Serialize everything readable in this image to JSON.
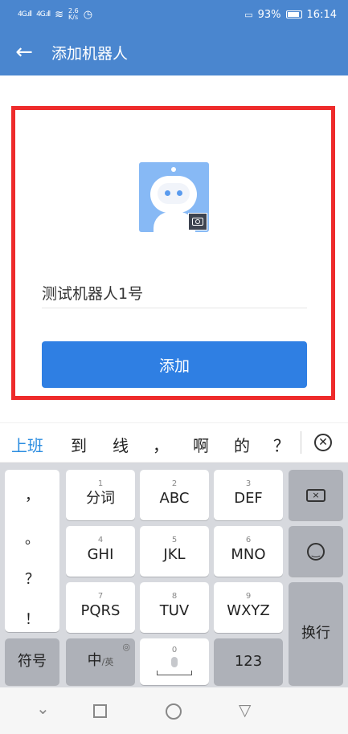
{
  "status_bar": {
    "signal1": "4G.ıll",
    "signal2": "4G.ıll",
    "net_speed": "2.6\nK/s",
    "battery_percent": "93%",
    "time": "16:14"
  },
  "app_bar": {
    "title": "添加机器人"
  },
  "form": {
    "robot_name_value": "测试机器人1号",
    "add_button_label": "添加"
  },
  "suggestions": [
    "上班",
    "到",
    "线",
    "，",
    "啊",
    "的",
    "？"
  ],
  "keyboard": {
    "punctuation": [
      "，",
      "。",
      "？",
      "！"
    ],
    "rows": [
      [
        {
          "num": "1",
          "label": "分词"
        },
        {
          "num": "2",
          "label": "ABC"
        },
        {
          "num": "3",
          "label": "DEF"
        }
      ],
      [
        {
          "num": "4",
          "label": "GHI"
        },
        {
          "num": "5",
          "label": "JKL"
        },
        {
          "num": "6",
          "label": "MNO"
        }
      ],
      [
        {
          "num": "7",
          "label": "PQRS"
        },
        {
          "num": "8",
          "label": "TUV"
        },
        {
          "num": "9",
          "label": "WXYZ"
        }
      ]
    ],
    "symbols_label": "符号",
    "chinese_label": "中",
    "english_label": "/英",
    "zero_label": "0",
    "numbers_label": "123",
    "enter_label": "换行"
  },
  "colors": {
    "app_bar": "#4a86cf",
    "button": "#2f7fe3",
    "highlight_border": "#ee2b2b",
    "suggestion_accent": "#2a8ce0"
  }
}
